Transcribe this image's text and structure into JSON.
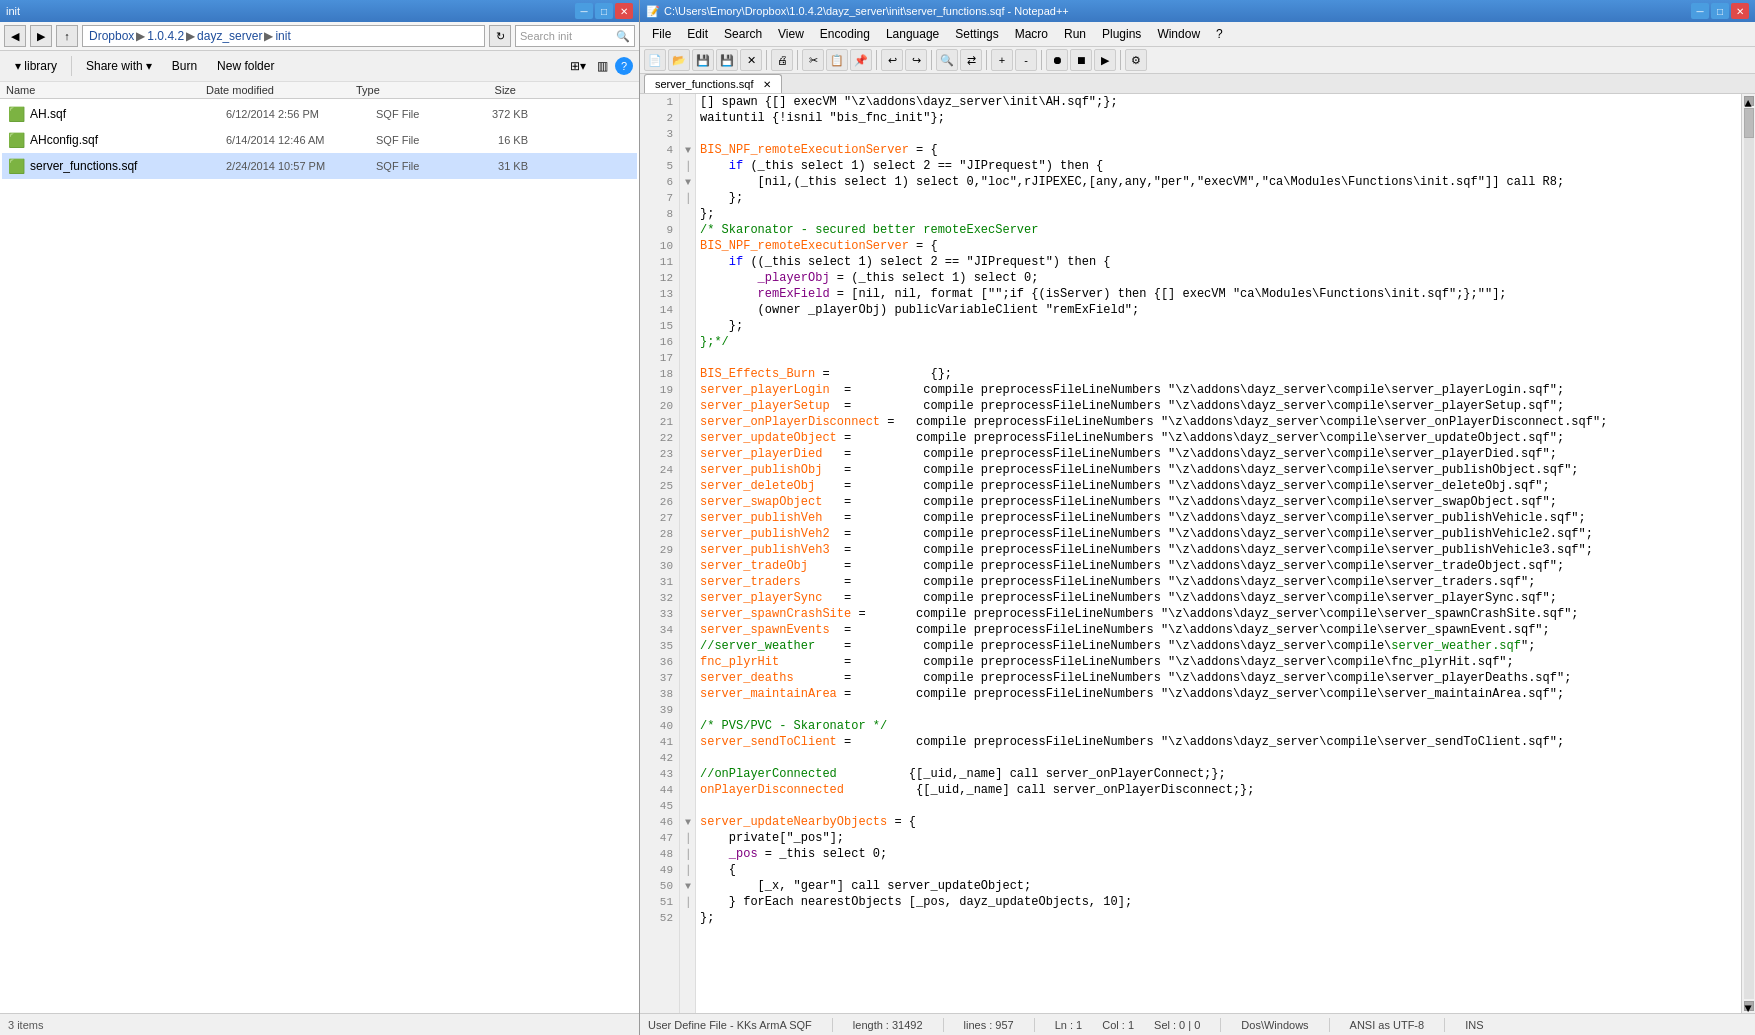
{
  "explorer": {
    "title": "init",
    "address": "Dropbox ▶ 1.0.4.2 ▶ dayz_server ▶ init",
    "search_placeholder": "Search init",
    "toolbar": {
      "library_btn": "▾ library",
      "share_btn": "Share with",
      "burn_btn": "Burn",
      "new_folder_btn": "New folder"
    },
    "columns": {
      "name": "Name",
      "date_modified": "Date modified",
      "type": "Type",
      "size": "Size"
    },
    "files": [
      {
        "name": "AH.sqf",
        "date": "6/12/2014 2:56 PM",
        "type": "SQF File",
        "size": "372 KB",
        "icon": "📄",
        "selected": false
      },
      {
        "name": "AHconfig.sqf",
        "date": "6/14/2014 12:46 AM",
        "type": "SQF File",
        "size": "16 KB",
        "icon": "📄",
        "selected": false
      },
      {
        "name": "server_functions.sqf",
        "date": "2/24/2014 10:57 PM",
        "type": "SQF File",
        "size": "31 KB",
        "icon": "📄",
        "selected": true
      }
    ],
    "status": "3 items"
  },
  "notepad": {
    "title": "C:\\Users\\Emory\\Dropbox\\1.0.4.2\\dayz_server\\init\\server_functions.sqf - Notepad++",
    "menu": [
      "File",
      "Edit",
      "Search",
      "View",
      "Encoding",
      "Language",
      "Settings",
      "Macro",
      "Run",
      "Plugins",
      "Window",
      "?"
    ],
    "active_tab": "server_functions.sqf",
    "status": {
      "file_type": "User Define File - KKs ArmA SQF",
      "length": "length : 31492",
      "lines": "lines : 957",
      "ln": "Ln : 1",
      "col": "Col : 1",
      "sel": "Sel : 0 | 0",
      "dos_windows": "Dos\\Windows",
      "encoding": "ANSI as UTF-8",
      "ins": "INS"
    }
  }
}
